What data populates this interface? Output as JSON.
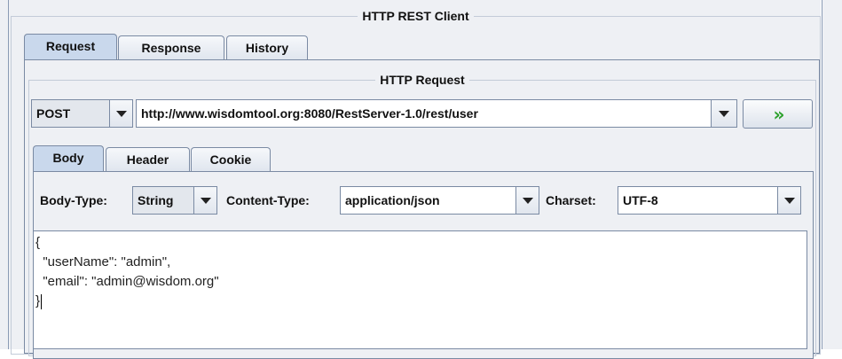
{
  "panel_title": "HTTP REST Client",
  "main_tabs": [
    {
      "label": "Request",
      "active": true
    },
    {
      "label": "Response",
      "active": false
    },
    {
      "label": "History",
      "active": false
    }
  ],
  "request": {
    "group_title": "HTTP Request",
    "method": "POST",
    "url": "http://www.wisdomtool.org:8080/RestServer-1.0/rest/user",
    "send_button_glyph": "»"
  },
  "sub_tabs": [
    {
      "label": "Body",
      "active": true
    },
    {
      "label": "Header",
      "active": false
    },
    {
      "label": "Cookie",
      "active": false
    }
  ],
  "body": {
    "body_type_label": "Body-Type:",
    "body_type_value": "String",
    "content_type_label": "Content-Type:",
    "content_type_value": "application/json",
    "charset_label": "Charset:",
    "charset_value": "UTF-8",
    "content_lines": [
      "{",
      "  \"userName\": \"admin\",",
      "  \"email\": \"admin@wisdom.org\"",
      "}"
    ]
  },
  "colors": {
    "window_bg": "#eef0f4",
    "active_tab": "#c9d8ec",
    "border": "#7a8aa3",
    "send_accent": "#2aa02a"
  }
}
